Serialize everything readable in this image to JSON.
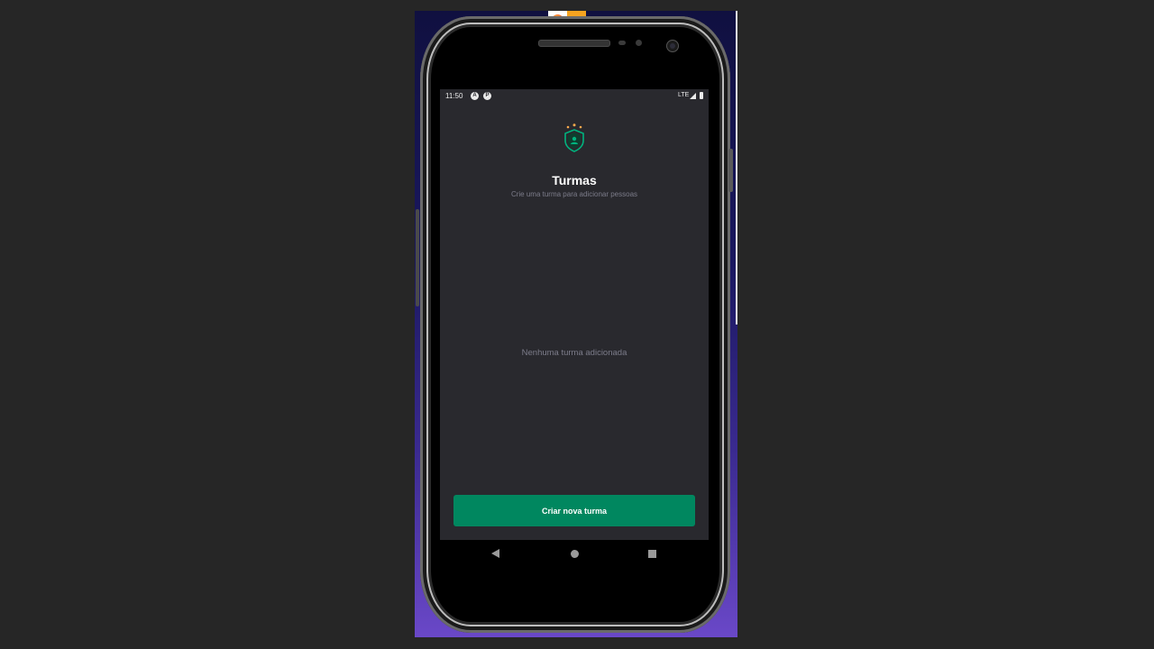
{
  "status_bar": {
    "time": "11:50",
    "network": "LTE"
  },
  "app": {
    "title": "Turmas",
    "subtitle": "Crie uma turma para adicionar pessoas",
    "empty_message": "Nenhuma turma adicionada",
    "create_button_label": "Criar nova turma"
  },
  "icons": {
    "logo": "shield-with-stars-icon",
    "status_a": "a-icon",
    "status_p": "p-icon",
    "signal": "signal-icon",
    "battery": "battery-icon",
    "nav_back": "back-triangle-icon",
    "nav_home": "home-circle-icon",
    "nav_recent": "recent-square-icon"
  },
  "colors": {
    "background": "#29292e",
    "accent": "#00875f",
    "text_muted": "#7c7c8a",
    "logo_green": "#00b37e",
    "logo_gold": "#fba94c"
  }
}
